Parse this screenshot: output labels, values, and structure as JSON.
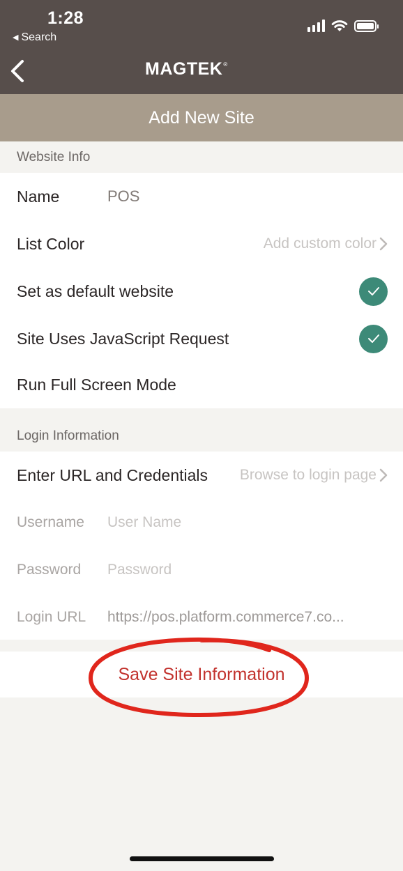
{
  "status_bar": {
    "time": "1:28",
    "back_to_app": "Search"
  },
  "nav": {
    "logo_text": "MAGTEK",
    "logo_mark": "®"
  },
  "title": "Add New Site",
  "website_info": {
    "header": "Website Info",
    "name_label": "Name",
    "name_value": "POS",
    "list_color_label": "List Color",
    "list_color_action": "Add custom color",
    "default_website_label": "Set as default website",
    "default_website_checked": true,
    "javascript_label": "Site Uses JavaScript Request",
    "javascript_checked": true,
    "full_screen_label": "Run Full Screen Mode",
    "full_screen_checked": false
  },
  "login_info": {
    "header": "Login Information",
    "url_creds_label": "Enter URL and Credentials",
    "url_creds_action": "Browse to login page",
    "username_label": "Username",
    "username_placeholder": "User Name",
    "password_label": "Password",
    "password_placeholder": "Password",
    "login_url_label": "Login URL",
    "login_url_value": "https://pos.platform.commerce7.co..."
  },
  "save_button": "Save Site Information",
  "colors": {
    "nav_bg": "#574e4b",
    "title_bg": "#a89c8c",
    "check_green": "#3d8a78",
    "save_red": "#c2322d",
    "annotation_red": "#e0261c"
  }
}
